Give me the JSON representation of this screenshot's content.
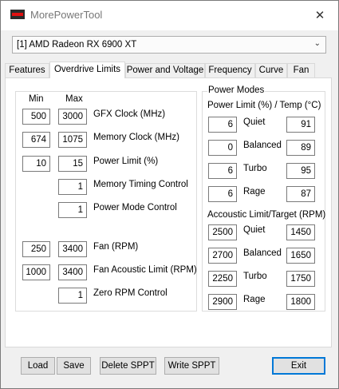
{
  "window": {
    "title": "MorePowerTool",
    "close_glyph": "✕"
  },
  "device_select": {
    "value": "[1] AMD Radeon RX 6900 XT",
    "chevron": "⌄"
  },
  "tabs": [
    {
      "label": "Features",
      "active": false
    },
    {
      "label": "Overdrive Limits",
      "active": true
    },
    {
      "label": "Power and Voltage",
      "active": false
    },
    {
      "label": "Frequency",
      "active": false
    },
    {
      "label": "Curve",
      "active": false
    },
    {
      "label": "Fan",
      "active": false
    }
  ],
  "overdrive": {
    "min_header": "Min",
    "max_header": "Max",
    "rows": [
      {
        "min": "500",
        "max": "3000",
        "label": "GFX Clock (MHz)"
      },
      {
        "min": "674",
        "max": "1075",
        "label": "Memory Clock (MHz)"
      },
      {
        "min": "10",
        "max": "15",
        "label": "Power Limit (%)"
      },
      {
        "min": "",
        "max": "1",
        "label": "Memory Timing Control"
      },
      {
        "min": "",
        "max": "1",
        "label": "Power Mode Control"
      },
      {
        "min": "250",
        "max": "3400",
        "label": "Fan (RPM)"
      },
      {
        "min": "1000",
        "max": "3400",
        "label": "Fan Acoustic Limit (RPM)"
      },
      {
        "min": "",
        "max": "1",
        "label": "Zero RPM Control"
      }
    ]
  },
  "power_modes": {
    "title": "Power Modes",
    "power_limit_header": "Power Limit (%) / Temp (°C)",
    "power_limit_rows": [
      {
        "mode": "Quiet",
        "limit": "6",
        "temp": "91"
      },
      {
        "mode": "Balanced",
        "limit": "0",
        "temp": "89"
      },
      {
        "mode": "Turbo",
        "limit": "6",
        "temp": "95"
      },
      {
        "mode": "Rage",
        "limit": "6",
        "temp": "87"
      }
    ],
    "acoustic_header": "Accoustic Limit/Target (RPM)",
    "acoustic_rows": [
      {
        "mode": "Quiet",
        "limit": "2500",
        "target": "1450"
      },
      {
        "mode": "Balanced",
        "limit": "2700",
        "target": "1650"
      },
      {
        "mode": "Turbo",
        "limit": "2250",
        "target": "1750"
      },
      {
        "mode": "Rage",
        "limit": "2900",
        "target": "1800"
      }
    ]
  },
  "buttons": {
    "load": "Load",
    "save": "Save",
    "delete_sppt": "Delete SPPT",
    "write_sppt": "Write SPPT",
    "exit": "Exit"
  },
  "colors": {
    "accent_blue": "#0078d7",
    "icon_red": "#e01010"
  }
}
